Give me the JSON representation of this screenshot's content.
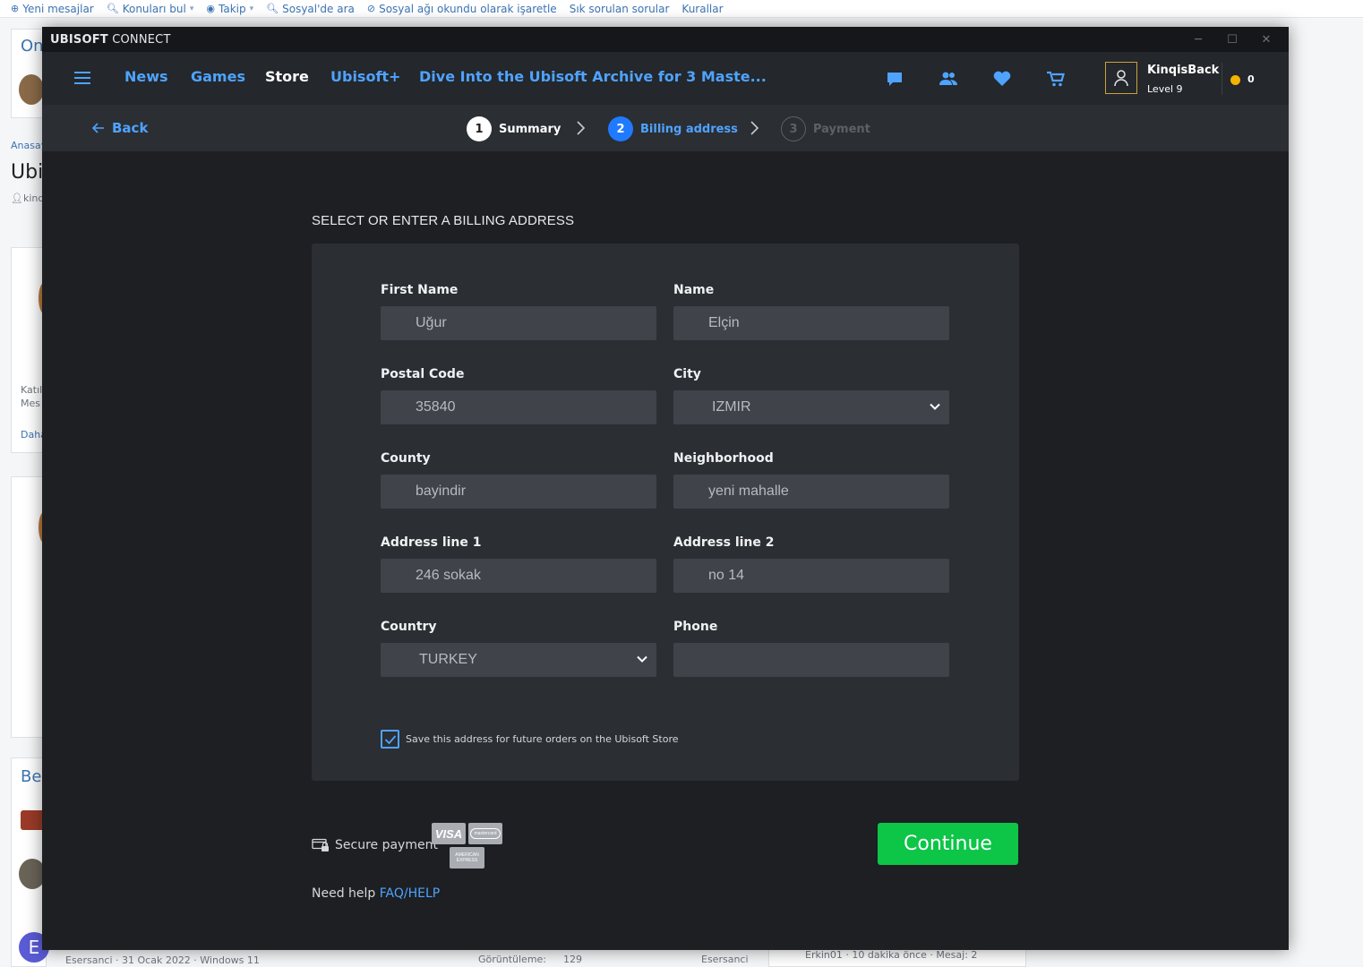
{
  "forum": {
    "topbar": [
      {
        "label": "Yeni mesajlar",
        "icon": "search-plus-icon"
      },
      {
        "label": "Konuları bul",
        "icon": "search-icon",
        "dropdown": true
      },
      {
        "label": "Takip",
        "icon": "eye-icon",
        "dropdown": true
      },
      {
        "label": "Sosyal'de ara",
        "icon": "search-icon"
      },
      {
        "label": "Sosyal ağı okundu olarak işaretle",
        "icon": "eye-slash-icon"
      },
      {
        "label": "Sık sorulan sorular"
      },
      {
        "label": "Kurallar"
      }
    ],
    "fragments": {
      "online_heading": "On",
      "breadcrumb": "Anasay",
      "thread_title": "Ubi",
      "author": "kinq",
      "katil": "Katıl",
      "mes": "Mes",
      "daha": "Daha",
      "ben": "Ber",
      "avatar_letter": "E",
      "footer_left": "Esersanci · 31 Ocak 2022 · Windows 11",
      "footer_views_label": "Görüntüleme:",
      "footer_views_value": "129",
      "footer_user": "Esersanci",
      "footer_right": "Erkin01 · 10 dakika önce · Mesaj: 2"
    }
  },
  "app": {
    "title_bold": "UBISOFT",
    "title_rest": " CONNECT",
    "nav": {
      "news": "News",
      "games": "Games",
      "store": "Store",
      "ubisoft_plus": "Ubisoft+",
      "promo": "Dive Into the Ubisoft Archive for 3 Maste..."
    },
    "user": {
      "name": "KinqisBack",
      "level": "Level 9",
      "coins": "0"
    }
  },
  "stepper": {
    "back": "Back",
    "steps": [
      {
        "num": "1",
        "label": "Summary",
        "state": "done"
      },
      {
        "num": "2",
        "label": "Billing address",
        "state": "active"
      },
      {
        "num": "3",
        "label": "Payment",
        "state": "pending"
      }
    ]
  },
  "billing": {
    "heading": "SELECT OR ENTER A BILLING ADDRESS",
    "fields": {
      "first_name": {
        "label": "First Name",
        "value": "Uğur"
      },
      "name": {
        "label": "Name",
        "value": "Elçin"
      },
      "postal_code": {
        "label": "Postal Code",
        "value": "35840"
      },
      "city": {
        "label": "City",
        "value": "IZMIR"
      },
      "county": {
        "label": "County",
        "value": "bayindir"
      },
      "neighborhood": {
        "label": "Neighborhood",
        "value": "yeni mahalle"
      },
      "address1": {
        "label": "Address line 1",
        "value": "246 sokak"
      },
      "address2": {
        "label": "Address line 2",
        "value": "no 14"
      },
      "country": {
        "label": "Country",
        "value": "TURKEY"
      },
      "phone": {
        "label": "Phone",
        "value": ""
      }
    },
    "save_checkbox": {
      "label": "Save this address for future orders on the Ubisoft Store",
      "checked": true
    }
  },
  "footer": {
    "secure": "Secure payment",
    "cards": {
      "visa": "VISA",
      "mastercard": "mastercard",
      "amex": "AMERICAN EXPRESS"
    },
    "help_prefix": "Need help ",
    "help_link": "FAQ/HELP",
    "continue": "Continue"
  },
  "colors": {
    "accent": "#4fa3ff",
    "continue": "#0dc547",
    "coin": "#f4b400",
    "panel": "#2b2e33",
    "background": "#1d1f22"
  }
}
